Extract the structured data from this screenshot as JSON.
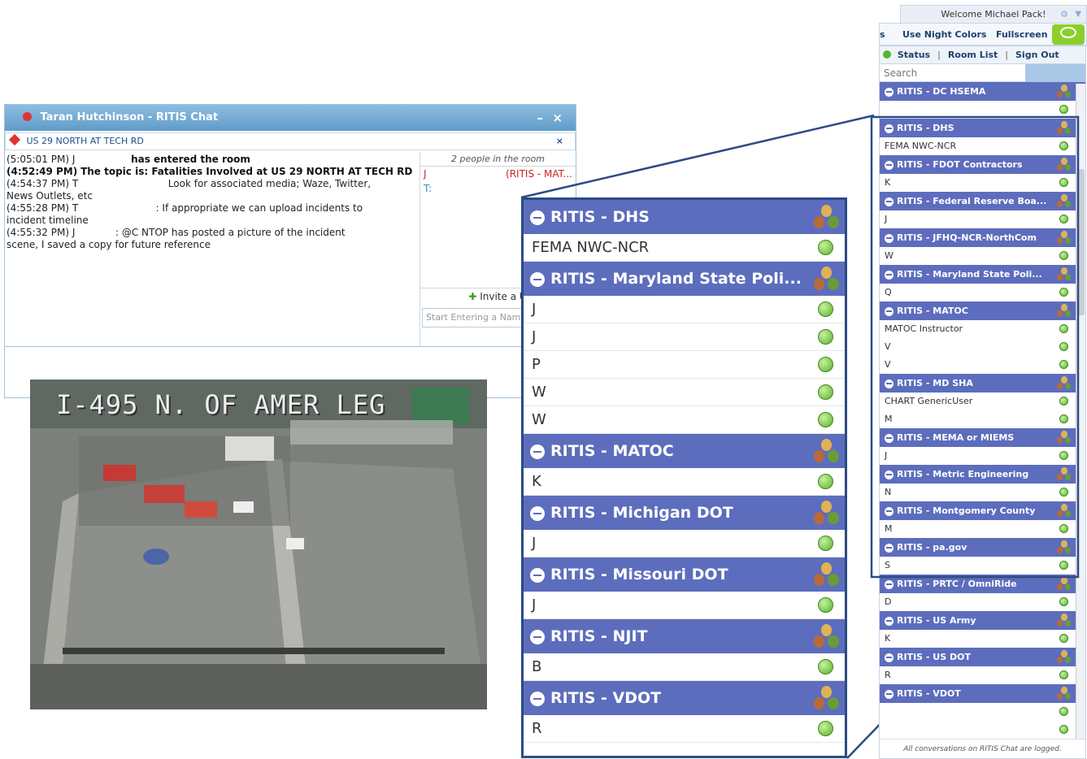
{
  "chat": {
    "title": "Taran Hutchinson - RITIS Chat",
    "topic": "US 29 NORTH AT TECH RD",
    "close_x": "×",
    "min": "–",
    "log": [
      {
        "ts": "(5:05:01 PM) J",
        "text": "has entered the room"
      },
      {
        "ts": "(4:52:49 PM)",
        "text": "The topic is: Fatalities Involved at US 29 NORTH AT TECH RD"
      },
      {
        "ts": "(4:54:37 PM) T",
        "text": "Look for associated media; Waze, Twitter,"
      },
      {
        "ts": "",
        "text": "News Outlets, etc"
      },
      {
        "ts": "(4:55:28 PM) T",
        "text": ": If appropriate we can upload incidents to"
      },
      {
        "ts": "",
        "text": "incident timeline"
      },
      {
        "ts": "(4:55:32 PM) J",
        "text": ": @C        NTOP has posted a picture of the incident"
      },
      {
        "ts": "",
        "text": "scene, I saved a copy for future reference"
      }
    ],
    "people_header": "2 people in the room",
    "people": [
      {
        "name": "J",
        "org": "(RITIS - MAT..."
      },
      {
        "name": "T:",
        "org": ""
      }
    ],
    "invite": "Invite a U",
    "invite_placeholder": "Start Entering a Name"
  },
  "camera": {
    "label": "I-495 N. OF AMER LEG"
  },
  "zoom_panel": [
    {
      "room": "RITIS - DHS",
      "people": [
        "FEMA NWC-NCR"
      ]
    },
    {
      "room": "RITIS - Maryland State Poli...",
      "people": [
        "J",
        "J",
        "P",
        "W",
        "W"
      ]
    },
    {
      "room": "RITIS - MATOC",
      "people": [
        "K"
      ]
    },
    {
      "room": "RITIS - Michigan DOT",
      "people": [
        "J"
      ]
    },
    {
      "room": "RITIS - Missouri DOT",
      "people": [
        "J"
      ]
    },
    {
      "room": "RITIS - NJIT",
      "people": [
        "B"
      ]
    },
    {
      "room": "RITIS - VDOT",
      "people": [
        "R"
      ]
    }
  ],
  "sidebar": {
    "welcome": "Welcome Michael Pack!",
    "buttons": [
      "s",
      "Use Night Colors",
      "Fullscreen"
    ],
    "status": "Status",
    "room_list": "Room List",
    "sign_out": "Sign Out",
    "sep": "|",
    "search_placeholder": "Search",
    "footer": "All conversations on RITIS Chat are logged.",
    "rooms": [
      {
        "room": "RITIS - DC HSEMA",
        "people": [
          ""
        ]
      },
      {
        "room": "RITIS - DHS",
        "people": [
          "FEMA NWC-NCR"
        ]
      },
      {
        "room": "RITIS - FDOT Contractors",
        "people": [
          "K"
        ]
      },
      {
        "room": "RITIS - Federal Reserve Boa...",
        "people": [
          "J"
        ]
      },
      {
        "room": "RITIS - JFHQ-NCR-NorthCom",
        "people": [
          "W"
        ]
      },
      {
        "room": "RITIS - Maryland State Poli...",
        "people": [
          "Q"
        ]
      },
      {
        "room": "RITIS - MATOC",
        "people": [
          "MATOC Instructor",
          "V",
          "V"
        ]
      },
      {
        "room": "RITIS - MD SHA",
        "people": [
          "CHART GenericUser",
          "M"
        ]
      },
      {
        "room": "RITIS - MEMA or MIEMS",
        "people": [
          "J"
        ]
      },
      {
        "room": "RITIS - Metric Engineering",
        "people": [
          "N"
        ]
      },
      {
        "room": "RITIS - Montgomery County",
        "people": [
          "M"
        ]
      },
      {
        "room": "RITIS - pa.gov",
        "people": [
          "S"
        ]
      },
      {
        "room": "RITIS - PRTC / OmniRide",
        "people": [
          "D"
        ]
      },
      {
        "room": "RITIS - US Army",
        "people": [
          "K"
        ]
      },
      {
        "room": "RITIS - US DOT",
        "people": [
          "R"
        ]
      },
      {
        "room": "RITIS - VDOT",
        "people": [
          "",
          ""
        ]
      }
    ]
  }
}
